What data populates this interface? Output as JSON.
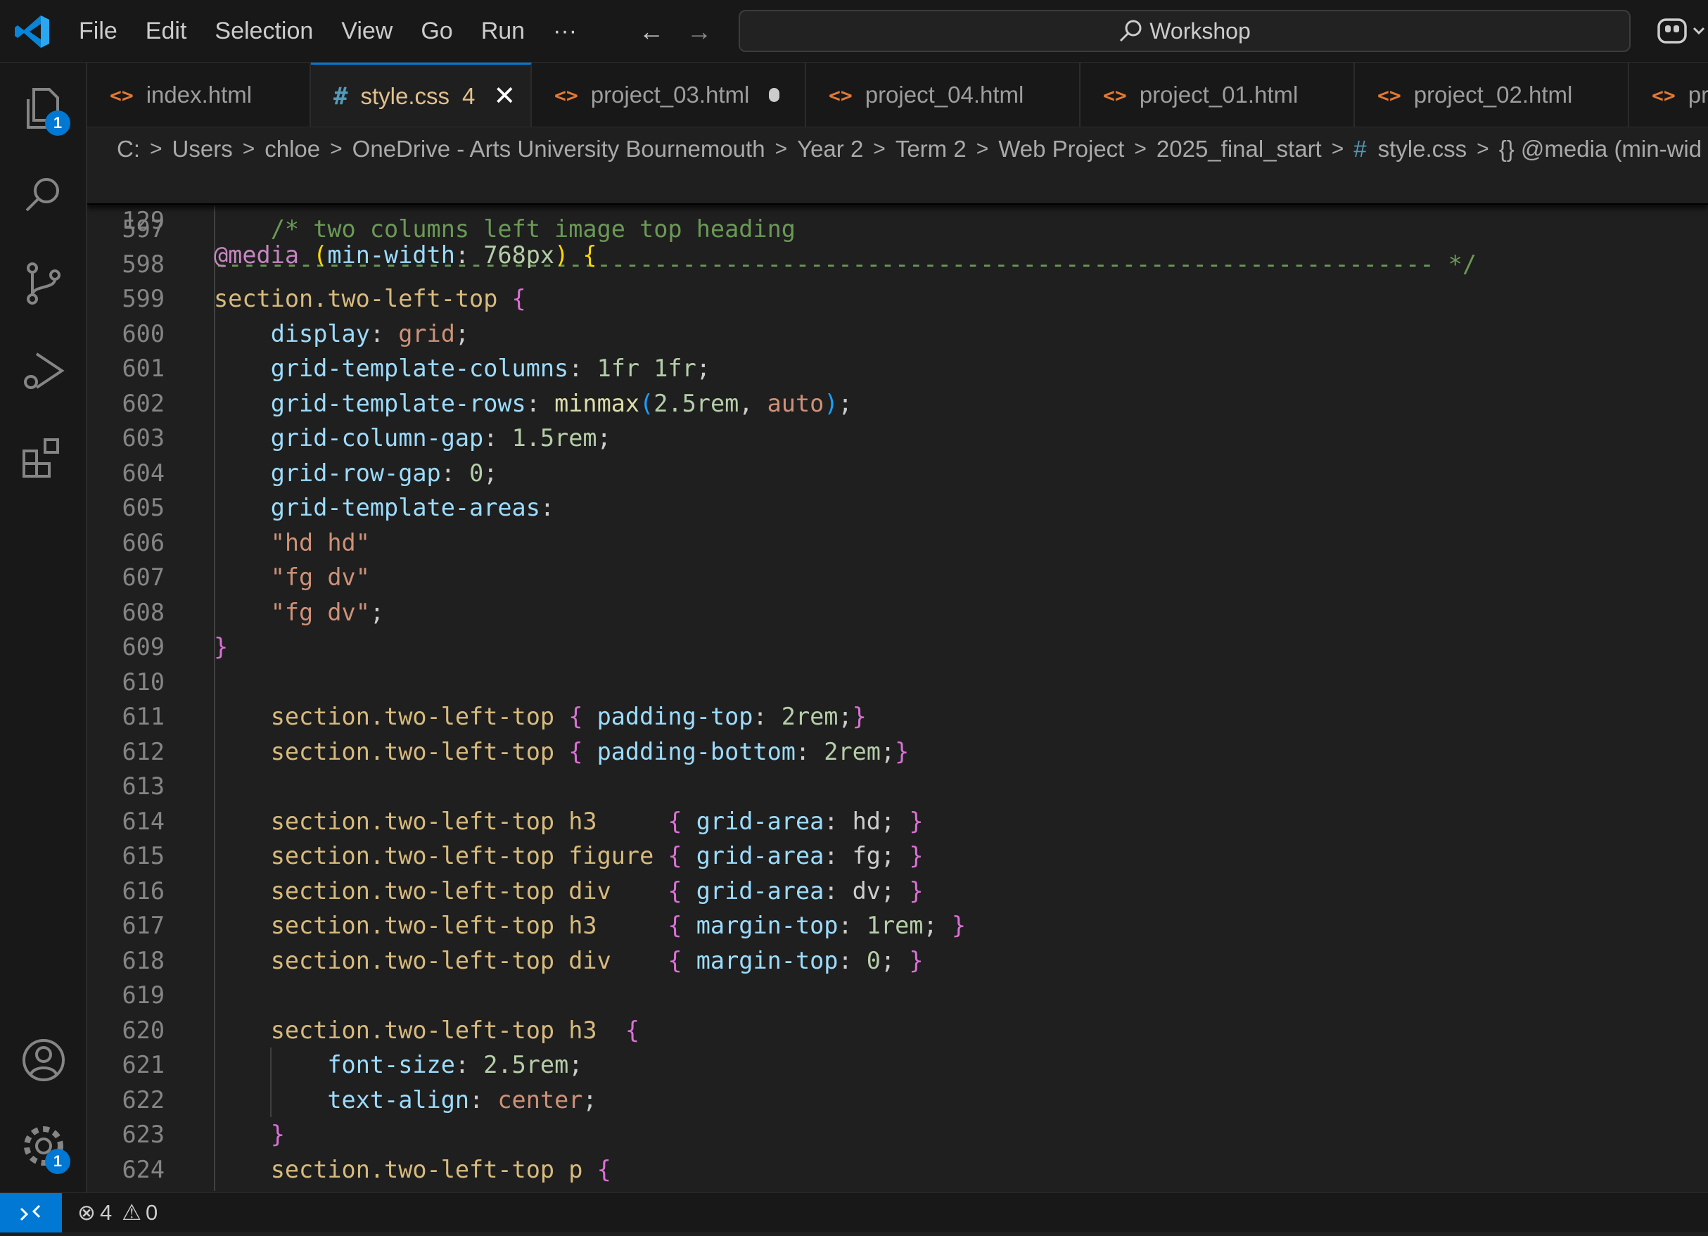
{
  "menu": [
    "File",
    "Edit",
    "Selection",
    "View",
    "Go",
    "Run",
    "···"
  ],
  "search": {
    "label": "Workshop"
  },
  "activity_badges": {
    "explorer": "1",
    "settings": "1"
  },
  "tabs": [
    {
      "name": "index.html",
      "icon": "<>",
      "type": "html"
    },
    {
      "name": "style.css",
      "icon": "#",
      "type": "css",
      "count": "4",
      "active": true
    },
    {
      "name": "project_03.html",
      "icon": "<>",
      "type": "html",
      "dirty": true
    },
    {
      "name": "project_04.html",
      "icon": "<>",
      "type": "html"
    },
    {
      "name": "project_01.html",
      "icon": "<>",
      "type": "html"
    },
    {
      "name": "project_02.html",
      "icon": "<>",
      "type": "html"
    },
    {
      "name": "pr",
      "icon": "<>",
      "type": "html"
    }
  ],
  "breadcrumb": [
    "C:",
    "Users",
    "chloe",
    "OneDrive - Arts University Bournemouth",
    "Year 2",
    "Term 2",
    "Web Project",
    "2025_final_start",
    "style.css",
    "{} @media (min-wid"
  ],
  "sticky": {
    "line": "129",
    "text": "@media (min-width: 768px) {"
  },
  "code_lines": [
    {
      "n": "597",
      "t": "    /* two columns left image top heading"
    },
    {
      "n": "598",
      "t": "-------------------------------------------------------------------------------------- */"
    },
    {
      "n": "599",
      "t": "section.two-left-top {"
    },
    {
      "n": "600",
      "t": "    display: grid;"
    },
    {
      "n": "601",
      "t": "    grid-template-columns: 1fr 1fr;"
    },
    {
      "n": "602",
      "t": "    grid-template-rows: minmax(2.5rem, auto);"
    },
    {
      "n": "603",
      "t": "    grid-column-gap: 1.5rem;"
    },
    {
      "n": "604",
      "t": "    grid-row-gap: 0;"
    },
    {
      "n": "605",
      "t": "    grid-template-areas:"
    },
    {
      "n": "606",
      "t": "    \"hd hd\""
    },
    {
      "n": "607",
      "t": "    \"fg dv\""
    },
    {
      "n": "608",
      "t": "    \"fg dv\";"
    },
    {
      "n": "609",
      "t": "}"
    },
    {
      "n": "610",
      "t": ""
    },
    {
      "n": "611",
      "t": "    section.two-left-top { padding-top: 2rem;}"
    },
    {
      "n": "612",
      "t": "    section.two-left-top { padding-bottom: 2rem;}"
    },
    {
      "n": "613",
      "t": ""
    },
    {
      "n": "614",
      "t": "    section.two-left-top h3     { grid-area: hd; }"
    },
    {
      "n": "615",
      "t": "    section.two-left-top figure { grid-area: fg; }"
    },
    {
      "n": "616",
      "t": "    section.two-left-top div    { grid-area: dv; }"
    },
    {
      "n": "617",
      "t": "    section.two-left-top h3     { margin-top: 1rem; }"
    },
    {
      "n": "618",
      "t": "    section.two-left-top div    { margin-top: 0; }"
    },
    {
      "n": "619",
      "t": ""
    },
    {
      "n": "620",
      "t": "    section.two-left-top h3  {"
    },
    {
      "n": "621",
      "t": "        font-size: 2.5rem;"
    },
    {
      "n": "622",
      "t": "        text-align: center;"
    },
    {
      "n": "623",
      "t": "    }"
    },
    {
      "n": "624",
      "t": "    section.two-left-top p {"
    }
  ],
  "status": {
    "errors": "4",
    "warnings": "0"
  },
  "colors": {
    "accent": "#0078d4",
    "background": "#1f1f1f",
    "chrome": "#181818"
  }
}
